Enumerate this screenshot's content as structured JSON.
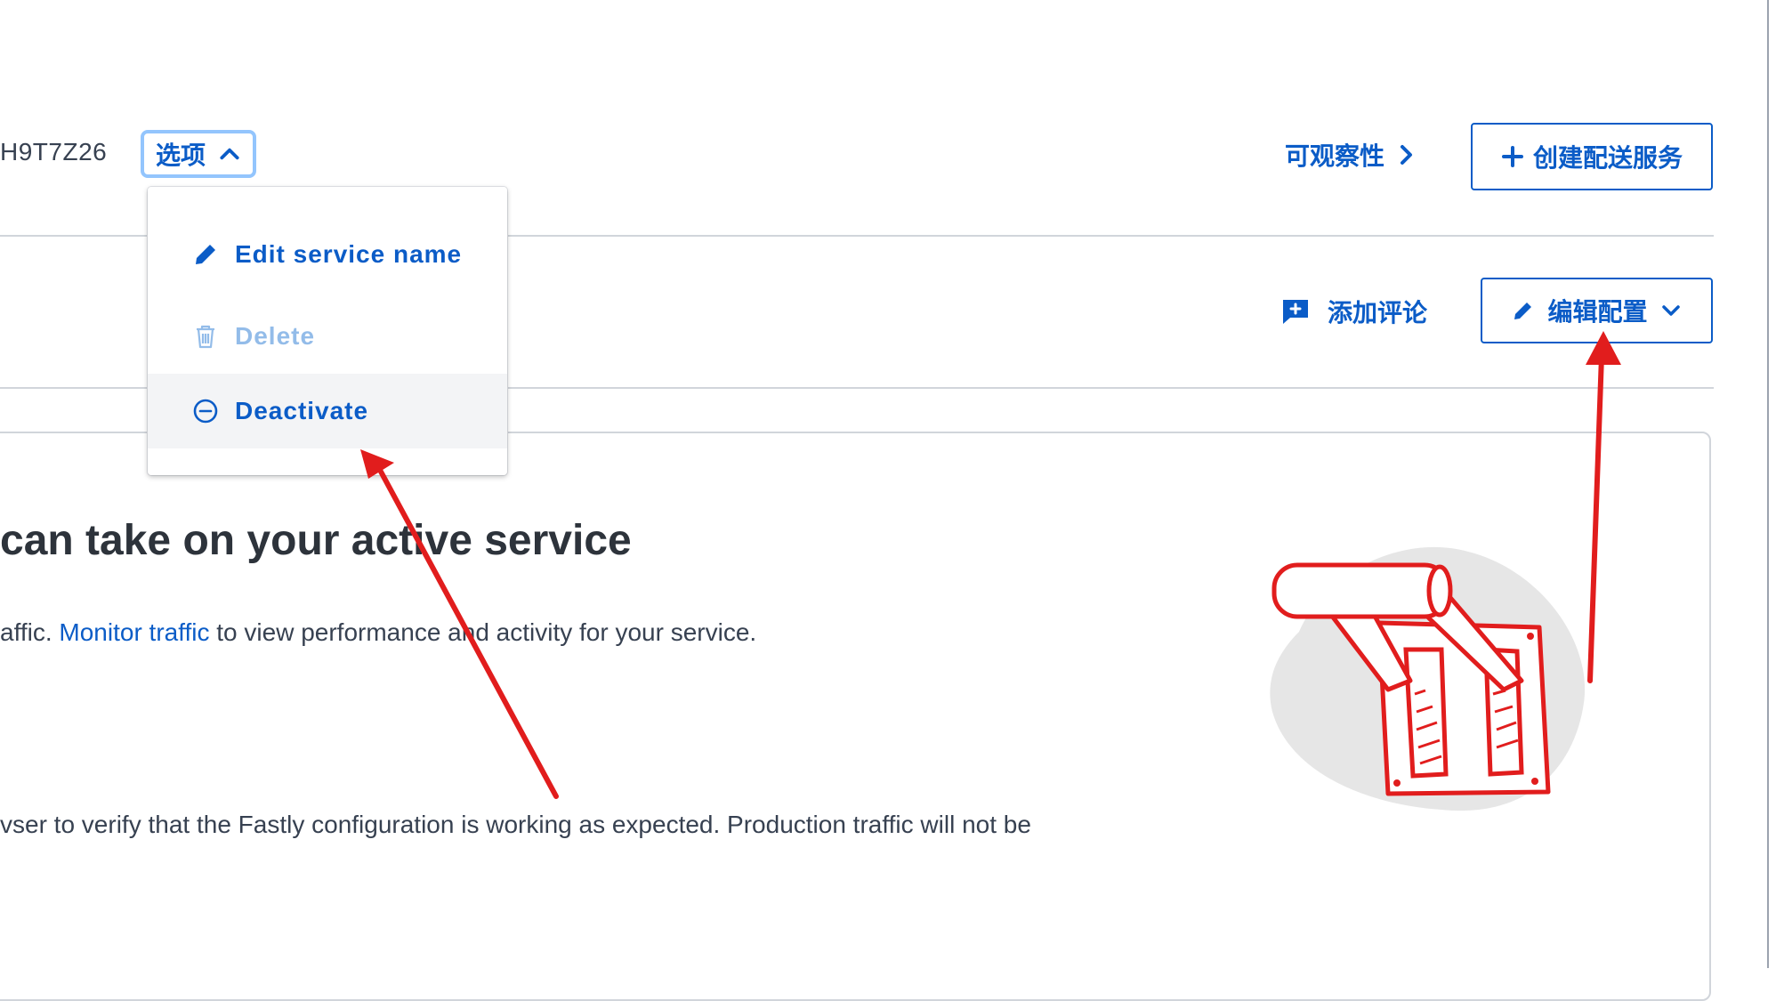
{
  "header": {
    "service_id": "H9T7Z26",
    "options_label": "选项",
    "observability_label": "可观察性",
    "create_button_label": "创建配送服务"
  },
  "toolbar": {
    "add_comment_label": "添加评论",
    "edit_config_label": "编辑配置"
  },
  "dropdown": {
    "items": [
      {
        "label": "Edit service name",
        "icon": "pencil-icon",
        "state": "enabled"
      },
      {
        "label": "Delete",
        "icon": "trash-icon",
        "state": "disabled"
      },
      {
        "label": "Deactivate",
        "icon": "minus-circle-icon",
        "state": "hovered"
      }
    ]
  },
  "content": {
    "headline": "can take on your active service",
    "para1_prefix": "affic. ",
    "para1_link": "Monitor traffic",
    "para1_suffix": " to view performance and activity for your service.",
    "para2": "vser to verify that the Fastly configuration is working as expected. Production traffic will not be"
  },
  "colors": {
    "accent": "#0b5cc7",
    "annotation": "#e11d1d",
    "border": "#d1d5db"
  }
}
